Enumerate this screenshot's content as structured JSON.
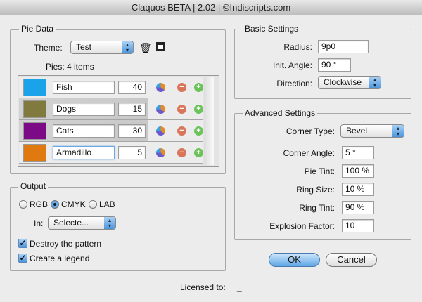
{
  "window": {
    "title": "Claquos BETA  |  2.02  |  ©Indiscripts.com"
  },
  "pie_data": {
    "label": "Pie Data",
    "theme_label": "Theme:",
    "theme_value": "Test",
    "pies_count": "Pies: 4 items",
    "items": [
      {
        "name": "Fish",
        "value": "40",
        "color": "#1aa3e8"
      },
      {
        "name": "Dogs",
        "value": "15",
        "color": "#807a3e"
      },
      {
        "name": "Cats",
        "value": "30",
        "color": "#7c0a86"
      },
      {
        "name": "Armadillo",
        "value": "5",
        "color": "#e07a10"
      }
    ]
  },
  "output": {
    "label": "Output",
    "radios": [
      {
        "label": "RGB",
        "selected": false
      },
      {
        "label": "CMYK",
        "selected": true
      },
      {
        "label": "LAB",
        "selected": false
      }
    ],
    "in_label": "In:",
    "in_value": "Selecte...",
    "checks": [
      {
        "label": "Destroy the pattern",
        "checked": true
      },
      {
        "label": "Create a legend",
        "checked": true
      }
    ]
  },
  "basic": {
    "label": "Basic Settings",
    "radius_label": "Radius:",
    "radius": "9p0",
    "angle_label": "Init. Angle:",
    "angle": "90 °",
    "direction_label": "Direction:",
    "direction": "Clockwise"
  },
  "advanced": {
    "label": "Advanced Settings",
    "corner_type_label": "Corner Type:",
    "corner_type": "Bevel",
    "corner_angle_label": "Corner Angle:",
    "corner_angle": "5 °",
    "pie_tint_label": "Pie Tint:",
    "pie_tint": "100 %",
    "ring_size_label": "Ring Size:",
    "ring_size": "10 %",
    "ring_tint_label": "Ring Tint:",
    "ring_tint": "90 %",
    "explosion_label": "Explosion Factor:",
    "explosion": "10"
  },
  "buttons": {
    "ok": "OK",
    "cancel": "Cancel"
  },
  "footer": {
    "licensed_label": "Licensed to:",
    "licensed_value": "_"
  }
}
